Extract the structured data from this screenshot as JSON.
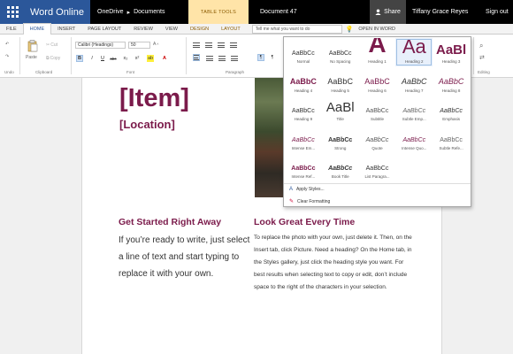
{
  "topbar": {
    "app_name": "Word Online",
    "path_location": "OneDrive",
    "path_separator": "▸",
    "path_folder": "Documents",
    "context_label": "TABLE TOOLS",
    "document_name": "Document 47",
    "share_label": "Share",
    "user_name": "Tiffany Grace Reyes",
    "signout_label": "Sign out"
  },
  "tabs": {
    "file": "FILE",
    "home": "HOME",
    "insert": "INSERT",
    "page_layout": "PAGE LAYOUT",
    "review": "REVIEW",
    "view": "VIEW",
    "design": "DESIGN",
    "layout": "LAYOUT",
    "tell_me_placeholder": "Tell me what you want to do",
    "open_in_word": "OPEN IN WORD"
  },
  "ribbon": {
    "undo_label": "Undo",
    "paste_label": "Paste",
    "cut_label": "Cut",
    "copy_label": "Copy",
    "clipboard_label": "Clipboard",
    "font_name": "Calibri (Headings)",
    "font_size": "50",
    "font_label": "Font",
    "paragraph_label": "Paragraph",
    "editing_label": "Editing",
    "bold": "B",
    "italic": "I",
    "underline": "U",
    "strike": "abc",
    "subscript": "x₂",
    "superscript": "x²",
    "highlight": "ab",
    "font_color": "A"
  },
  "document": {
    "title": "[Item]",
    "location": "[Location]",
    "left_heading": "Get Started Right Away",
    "left_body": "If you’re ready to write, just select a line of text and start typing to replace it with your own.",
    "right_heading": "Look Great Every Time",
    "right_body": "To replace the photo with your own, just delete it. Then, on the Insert tab, click Picture. Need a heading? On the Home tab, in the Styles gallery, just click the heading style you want. For best results when selecting text to copy or edit, don’t include space to the right of the characters in your selection."
  },
  "gallery": {
    "styles": [
      {
        "sample": "AaBbCc",
        "name": "Normal"
      },
      {
        "sample": "AaBbCc",
        "name": "No Spacing"
      },
      {
        "sample": "A",
        "name": "Heading 1"
      },
      {
        "sample": "Aa",
        "name": "Heading 2"
      },
      {
        "sample": "AaBl",
        "name": "Heading 3"
      },
      {
        "sample": "AaBbC",
        "name": "Heading 4"
      },
      {
        "sample": "AaBbC",
        "name": "Heading 5"
      },
      {
        "sample": "AaBbC",
        "name": "Heading 6"
      },
      {
        "sample": "AaBbC",
        "name": "Heading 7"
      },
      {
        "sample": "AaBbC",
        "name": "Heading 8"
      },
      {
        "sample": "AaBbCc",
        "name": "Heading 9"
      },
      {
        "sample": "AaBl",
        "name": "Title"
      },
      {
        "sample": "AaBbCc",
        "name": "Subtitle"
      },
      {
        "sample": "AaBbCc",
        "name": "Subtle Emp..."
      },
      {
        "sample": "AaBbCc",
        "name": "Emphasis"
      },
      {
        "sample": "AaBbCc",
        "name": "Intense Em..."
      },
      {
        "sample": "AaBbCc",
        "name": "Strong"
      },
      {
        "sample": "AaBbCc",
        "name": "Quote"
      },
      {
        "sample": "AaBbCc",
        "name": "Intense Quo..."
      },
      {
        "sample": "AaBbCc",
        "name": "Subtle Refe..."
      },
      {
        "sample": "AaBbCc",
        "name": "Intense Ref..."
      },
      {
        "sample": "AaBbCc",
        "name": "Book Title"
      },
      {
        "sample": "AaBbCc",
        "name": "List Paragra..."
      }
    ],
    "apply_styles": "Apply Styles...",
    "clear_formatting": "Clear Formatting"
  },
  "colors": {
    "accent": "#2b579a",
    "heading": "#7b1b4b",
    "context_tab": "#ffe4a8"
  }
}
